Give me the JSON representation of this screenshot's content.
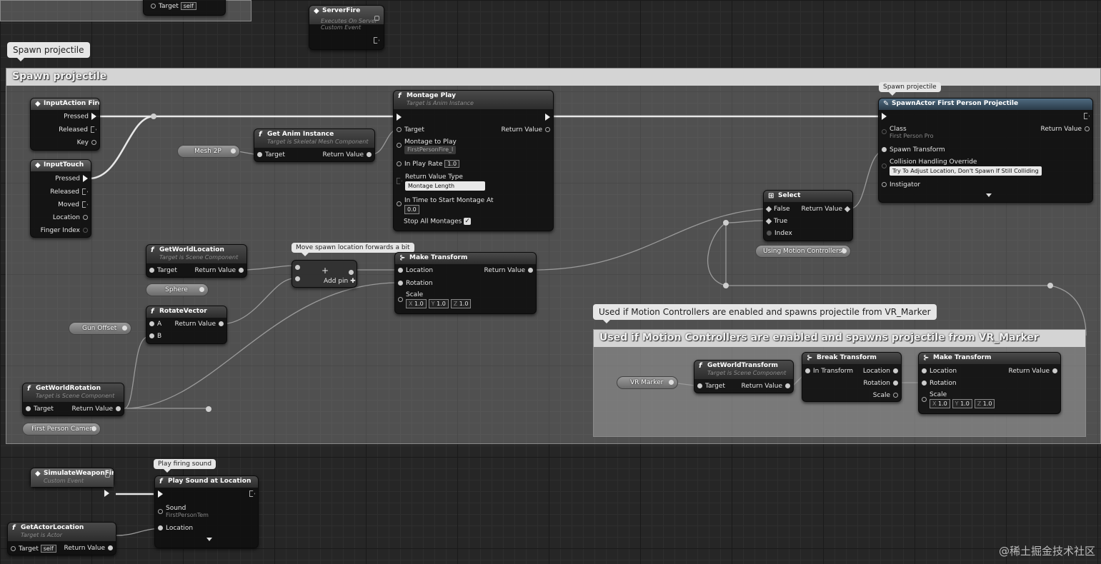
{
  "comments": {
    "main_tab": "Spawn projectile",
    "main_header": "Spawn projectile",
    "vr_bubble": "Used if Motion Controllers are enabled and spawns projectile from VR_Marker",
    "vr_header": "Used if Motion Controllers are enabled and spawns projectile from VR_Marker",
    "move_spawn": "Move spawn location forwards a bit",
    "spawn_bubble": "Spawn projectile",
    "play_sound_bubble": "Play firing sound"
  },
  "top_node": {
    "target_label": "Target",
    "target_value": "self"
  },
  "server_fire": {
    "title": "ServerFire",
    "sub1": "Executes On Server",
    "sub2": "Custom Event"
  },
  "input_fire": {
    "title": "InputAction Fire",
    "pressed": "Pressed",
    "released": "Released",
    "key": "Key"
  },
  "input_touch": {
    "title": "InputTouch",
    "pressed": "Pressed",
    "released": "Released",
    "moved": "Moved",
    "location": "Location",
    "finger": "Finger Index"
  },
  "get_anim": {
    "title": "Get Anim Instance",
    "sub": "Target is Skeletal Mesh Component",
    "target": "Target",
    "ret": "Return Value"
  },
  "mesh2p": "Mesh 2P",
  "montage": {
    "title": "Montage Play",
    "sub": "Target is Anim Instance",
    "target": "Target",
    "ret": "Return Value",
    "montage_label": "Montage to Play",
    "montage_value": "FirstPersonFire_l",
    "rate_label": "In Play Rate",
    "rate_value": "1.0",
    "rvt_label": "Return Value Type",
    "rvt_value": "Montage Length",
    "time_label": "In Time to Start Montage At",
    "time_value": "0.0",
    "stop_label": "Stop All Montages"
  },
  "spawn_actor": {
    "title": "SpawnActor First Person Projectile",
    "class": "Class",
    "class_value": "First Person Pro",
    "ret": "Return Value",
    "spawn_transform": "Spawn Transform",
    "collision": "Collision Handling Override",
    "collision_value": "Try To Adjust Location, Don't Spawn If Still Colliding",
    "instigator": "Instigator"
  },
  "select": {
    "title": "Select",
    "false": "False",
    "true": "True",
    "index": "Index",
    "ret": "Return Value"
  },
  "using_mc": "Using Motion Controllers?",
  "get_world_loc": {
    "title": "GetWorldLocation",
    "sub": "Target is Scene Component",
    "target": "Target",
    "ret": "Return Value"
  },
  "sphere": "Sphere",
  "add_node": {
    "label": "Add pin"
  },
  "make_transform": {
    "title": "Make Transform",
    "location": "Location",
    "rotation": "Rotation",
    "scale": "Scale",
    "ret": "Return Value",
    "x": "X",
    "y": "Y",
    "z": "Z",
    "xv": "1.0",
    "yv": "1.0",
    "zv": "1.0"
  },
  "rotate_vector": {
    "title": "RotateVector",
    "a": "A",
    "b": "B",
    "ret": "Return Value"
  },
  "gun_offset": "Gun Offset",
  "get_world_rot": {
    "title": "GetWorldRotation",
    "sub": "Target is Scene Component",
    "target": "Target",
    "ret": "Return Value"
  },
  "fp_camera": "First Person Camera",
  "vr_marker": "VR Marker",
  "get_world_transform": {
    "title": "GetWorldTransform",
    "sub": "Target is Scene Component",
    "target": "Target",
    "ret": "Return Value"
  },
  "break_transform": {
    "title": "Break Transform",
    "in": "In Transform",
    "location": "Location",
    "rotation": "Rotation",
    "scale": "Scale"
  },
  "make_transform2": {
    "title": "Make Transform",
    "location": "Location",
    "rotation": "Rotation",
    "scale": "Scale",
    "ret": "Return Value",
    "x": "X",
    "y": "Y",
    "z": "Z",
    "xv": "1.0",
    "yv": "1.0",
    "zv": "1.0"
  },
  "simulate": {
    "title": "SimulateWeaponFire",
    "sub": "Custom Event"
  },
  "play_sound": {
    "title": "Play Sound at Location",
    "sound": "Sound",
    "sound_value": "FirstPersonTem",
    "location": "Location"
  },
  "get_actor_loc": {
    "title": "GetActorLocation",
    "sub": "Target is Actor",
    "target": "Target",
    "target_value": "self",
    "ret": "Return Value"
  },
  "watermark": "@稀土掘金技术社区"
}
